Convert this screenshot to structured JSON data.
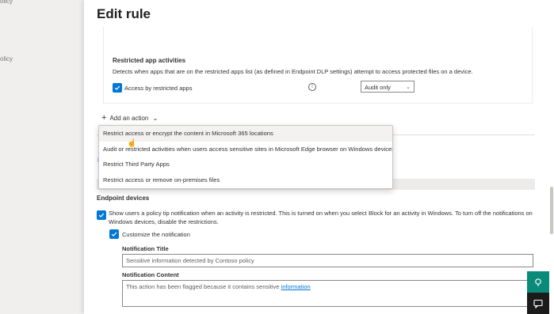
{
  "nav_fragments": [
    "olicy",
    "olicy"
  ],
  "title": "Edit rule",
  "restricted": {
    "heading": "Restricted app activities",
    "description": "Detects when apps that are on the restricted apps list (as defined in Endpoint DLP settings) attempt to access protected files on a device.",
    "checkbox_label": "Access by restricted apps",
    "checked": true,
    "mode_value": "Audit only"
  },
  "add_action_label": "Add an action",
  "dropdown_items": [
    "Restrict access or encrypt the content in Microsoft 365 locations",
    "Audit or restricted activities when users access sensitive sites in Microsoft Edge browser on Windows devices",
    "Restrict Third Party Apps",
    "Restrict access or remove on-premises files"
  ],
  "endpoint": {
    "heading": "Endpoint devices",
    "notify_text": "Show users a policy tip notification when an activity is restricted. This is turned on when you select Block for an activity in Windows. To turn off the notifications on Windows devices, disable the restrictions.",
    "customize_label": "Customize the notification",
    "notification_title_label": "Notification Title",
    "notification_title_value": "Sensitive information detected by Contoso policy",
    "notification_content_label": "Notification Content",
    "notification_content_value": "This action has been flagged because it contains sensitive",
    "notification_content_link": "information"
  },
  "icons": [
    "plus-icon",
    "chevron-down-icon",
    "info-icon",
    "check-icon",
    "feedback-icon",
    "chat-icon",
    "cursor-icon"
  ],
  "colors": {
    "accent": "#0078d4",
    "fab_teal": "#0a8a7a",
    "fab_dark": "#1b1b1b"
  }
}
